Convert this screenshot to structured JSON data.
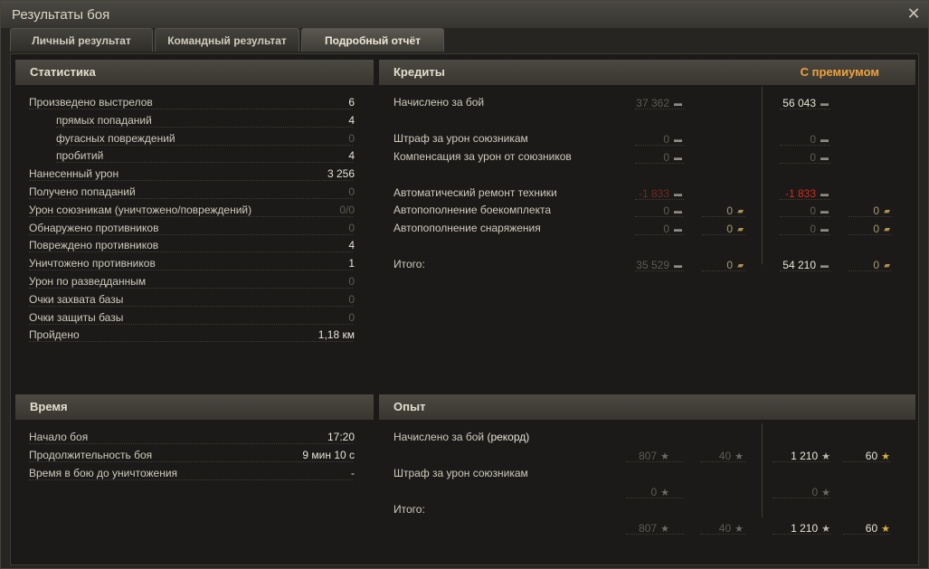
{
  "window": {
    "title": "Результаты боя"
  },
  "tabs": [
    {
      "label": "Личный результат"
    },
    {
      "label": "Командный результат"
    },
    {
      "label": "Подробный отчёт"
    }
  ],
  "stats": {
    "header": "Статистика",
    "rows": [
      {
        "label": "Произведено выстрелов",
        "value": "6"
      },
      {
        "label": "прямых попаданий",
        "value": "4"
      },
      {
        "label": "фугасных повреждений",
        "value": "0"
      },
      {
        "label": "пробитий",
        "value": "4"
      },
      {
        "label": "Нанесенный урон",
        "value": "3 256"
      },
      {
        "label": "Получено попаданий",
        "value": "0"
      },
      {
        "label": "Урон союзникам (уничтожено/повреждений)",
        "value": "0/0"
      },
      {
        "label": "Обнаружено противников",
        "value": "0"
      },
      {
        "label": "Повреждено противников",
        "value": "4"
      },
      {
        "label": "Уничтожено противников",
        "value": "1"
      },
      {
        "label": "Урон по разведданным",
        "value": "0"
      },
      {
        "label": "Очки захвата базы",
        "value": "0"
      },
      {
        "label": "Очки защиты базы",
        "value": "0"
      },
      {
        "label": "Пройдено",
        "value": "1,18 км"
      }
    ]
  },
  "credits": {
    "header": "Кредиты",
    "premium_header": "С премиумом",
    "rows": [
      {
        "label": "Начислено за бой",
        "credits": "37 362",
        "gold": "",
        "prem_credits": "56 043",
        "prem_gold": ""
      },
      {
        "label": "Штраф за урон союзникам",
        "credits": "0",
        "gold": "",
        "prem_credits": "0",
        "prem_gold": ""
      },
      {
        "label": "Компенсация за урон от союзников",
        "credits": "0",
        "gold": "",
        "prem_credits": "0",
        "prem_gold": ""
      },
      {
        "label": "Автоматический ремонт техники",
        "credits": "-1 833",
        "gold": "",
        "prem_credits": "-1 833",
        "prem_gold": ""
      },
      {
        "label": "Автопополнение боекомплекта",
        "credits": "0",
        "gold": "0",
        "prem_credits": "0",
        "prem_gold": "0"
      },
      {
        "label": "Автопополнение снаряжения",
        "credits": "0",
        "gold": "0",
        "prem_credits": "0",
        "prem_gold": "0"
      },
      {
        "label": "Итого:",
        "credits": "35 529",
        "gold": "0",
        "prem_credits": "54 210",
        "prem_gold": "0"
      }
    ]
  },
  "time": {
    "header": "Время",
    "rows": [
      {
        "label": "Начало боя",
        "value": "17:20"
      },
      {
        "label": "Продолжительность боя",
        "value": "9 мин 10 с"
      },
      {
        "label": "Время в бою до уничтожения",
        "value": "-"
      }
    ]
  },
  "exp": {
    "header": "Опыт",
    "earned_label": "Начислено за бой",
    "record_label": "(рекорд)",
    "penalty_label": "Штраф за урон союзникам",
    "total_label": "Итого:",
    "earned": {
      "xp": "807",
      "free": "40",
      "prem_xp": "1 210",
      "prem_free": "60"
    },
    "penalty": {
      "xp": "0",
      "prem_xp": "0"
    },
    "total": {
      "xp": "807",
      "free": "40",
      "prem_xp": "1 210",
      "prem_free": "60"
    }
  },
  "icons": {
    "credit": "credit-coin-icon",
    "gold": "gold-coin-icon",
    "xp": "xp-star-icon",
    "free_xp": "free-xp-star-icon",
    "close": "close-icon"
  },
  "colors": {
    "premium": "#f0a23c",
    "negative": "#d12a20",
    "star_gold": "#d8b040"
  }
}
